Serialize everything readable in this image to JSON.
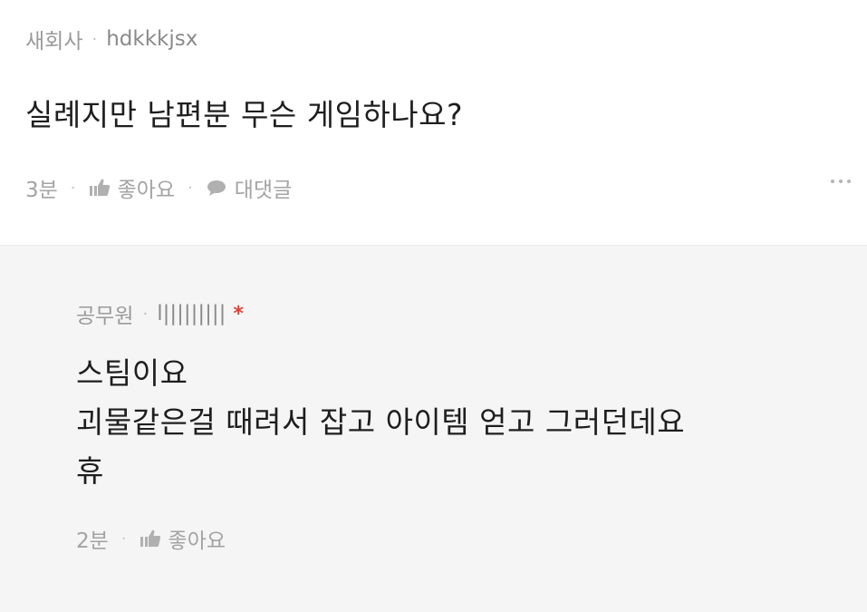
{
  "comments": [
    {
      "author_label": "새회사",
      "nickname": "hdkkkjsx",
      "text_lines": [
        "실례지만 남편분 무슨 게임하나요?"
      ],
      "time": "3분",
      "like_label": "좋아요",
      "reply_label": "대댓글"
    },
    {
      "author_label": "공무원",
      "nickname": "l|||||||||",
      "writer_mark": "*",
      "text_lines": [
        "스팀이요",
        "괴물같은걸 때려서 잡고 아이템 얻고 그러던데요",
        "휴"
      ],
      "time": "2분",
      "like_label": "좋아요"
    }
  ],
  "icons": {
    "like": "thumbs-up-icon",
    "reply": "speech-bubble-icon",
    "more": "more-dots-icon"
  },
  "colors": {
    "reply_background": "#f5f5f5",
    "meta_text": "#9a9a9a",
    "writer_mark": "#e0433d"
  }
}
